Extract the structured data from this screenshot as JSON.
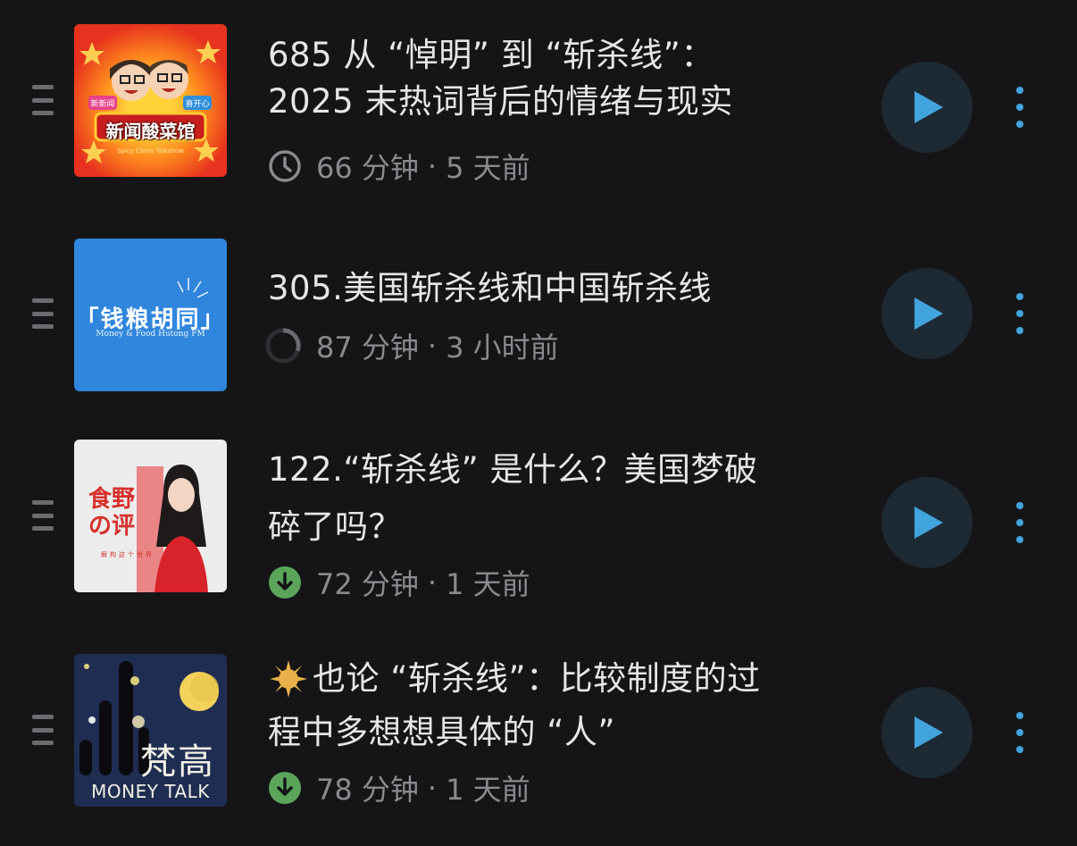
{
  "episodes": [
    {
      "title_line1": "685 从 “悼明” 到 “斩杀线”：",
      "title_line2": "2025 末热词背后的情绪与现实",
      "duration": "66 分钟",
      "separator": "·",
      "age": "5 天前",
      "status_icon": "clock-icon",
      "artwork": {
        "text": "新闻酸菜馆",
        "subtext": "Spicy China Talkshow",
        "left_badge": "新新闻",
        "right_badge": "喜开心"
      }
    },
    {
      "title_line1": "305.美国斩杀线和中国斩杀线",
      "title_line2": "",
      "duration": "87 分钟",
      "separator": "·",
      "age": "3 小时前",
      "status_icon": "progress-ring-icon",
      "progress": 0.3,
      "artwork": {
        "text": "「钱粮胡同」",
        "subtext": "Money & Food Hutong FM"
      }
    },
    {
      "title_line1": "122.“斩杀线” 是什么？美国梦破",
      "title_line2": "碎了吗？",
      "duration": "72 分钟",
      "separator": "·",
      "age": "1 天前",
      "status_icon": "downloaded-icon",
      "artwork": {
        "text_line1": "食野",
        "text_line2": "の评",
        "subtext": "解构这个世界"
      }
    },
    {
      "title_line1": "也论 “斩杀线”：比较制度的过",
      "title_line2": "程中多想想具体的 “人”",
      "duration": "78 分钟",
      "separator": "·",
      "age": "1 天前",
      "status_icon": "downloaded-icon",
      "title_prefix_icon": "sun-badge-icon",
      "artwork": {
        "text": "梵高",
        "subtext": "MONEY TALK"
      }
    }
  ],
  "colors": {
    "background": "#151518",
    "title": "#e6e6e8",
    "meta": "#8a8a8f",
    "accent": "#42a4dc",
    "play_bg": "#1d2a33",
    "download_green": "#5aa55a"
  }
}
